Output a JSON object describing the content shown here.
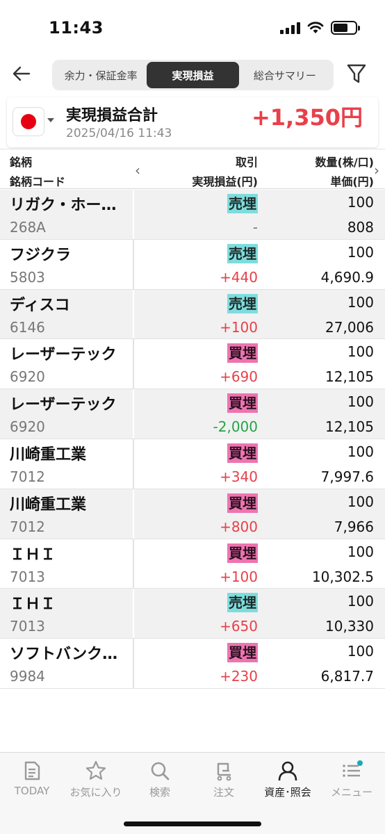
{
  "status_bar": {
    "time": "11:43"
  },
  "header": {
    "back_icon": "arrow-left-icon",
    "tabs": [
      {
        "label": "余力・保証金率",
        "active": false
      },
      {
        "label": "実現損益",
        "active": true
      },
      {
        "label": "総合サマリー",
        "active": false
      }
    ],
    "filter_icon": "filter-icon"
  },
  "summary": {
    "title": "実現損益合計",
    "date": "2025/04/16 11:43",
    "total": "+1,350円",
    "country": "Japan"
  },
  "table": {
    "headers": {
      "col1_top": "銘柄",
      "col1_bottom": "銘柄コード",
      "col2_top": "取引",
      "col2_bottom": "実現損益(円)",
      "col3_top": "数量(株/口)",
      "col3_bottom": "単価(円)"
    },
    "rows": [
      {
        "name": "リガク・ホー…",
        "code": "268A",
        "trade": "売埋",
        "trade_type": "sell",
        "pnl": "-",
        "pnl_color": "#777777",
        "qty": "100",
        "price": "808"
      },
      {
        "name": "フジクラ",
        "code": "5803",
        "trade": "売埋",
        "trade_type": "sell",
        "pnl": "+440",
        "pnl_color": "#e8404a",
        "qty": "100",
        "price": "4,690.9"
      },
      {
        "name": "ディスコ",
        "code": "6146",
        "trade": "売埋",
        "trade_type": "sell",
        "pnl": "+100",
        "pnl_color": "#e8404a",
        "qty": "100",
        "price": "27,006"
      },
      {
        "name": "レーザーテック",
        "code": "6920",
        "trade": "買埋",
        "trade_type": "buy",
        "pnl": "+690",
        "pnl_color": "#e8404a",
        "qty": "100",
        "price": "12,105"
      },
      {
        "name": "レーザーテック",
        "code": "6920",
        "trade": "買埋",
        "trade_type": "buy",
        "pnl": "-2,000",
        "pnl_color": "#22a447",
        "qty": "100",
        "price": "12,105"
      },
      {
        "name": "川崎重工業",
        "code": "7012",
        "trade": "買埋",
        "trade_type": "buy",
        "pnl": "+340",
        "pnl_color": "#e8404a",
        "qty": "100",
        "price": "7,997.6"
      },
      {
        "name": "川崎重工業",
        "code": "7012",
        "trade": "買埋",
        "trade_type": "buy",
        "pnl": "+800",
        "pnl_color": "#e8404a",
        "qty": "100",
        "price": "7,966"
      },
      {
        "name": "ＩＨＩ",
        "code": "7013",
        "trade": "買埋",
        "trade_type": "buy",
        "pnl": "+100",
        "pnl_color": "#e8404a",
        "qty": "100",
        "price": "10,302.5"
      },
      {
        "name": "ＩＨＩ",
        "code": "7013",
        "trade": "売埋",
        "trade_type": "sell",
        "pnl": "+650",
        "pnl_color": "#e8404a",
        "qty": "100",
        "price": "10,330"
      },
      {
        "name": "ソフトバンク…",
        "code": "9984",
        "trade": "買埋",
        "trade_type": "buy",
        "pnl": "+230",
        "pnl_color": "#e8404a",
        "qty": "100",
        "price": "6,817.7"
      }
    ]
  },
  "tabbar": {
    "items": [
      {
        "label": "TODAY",
        "icon": "news-icon",
        "active": false
      },
      {
        "label": "お気に入り",
        "icon": "star-icon",
        "active": false
      },
      {
        "label": "検索",
        "icon": "search-icon",
        "active": false
      },
      {
        "label": "注文",
        "icon": "cart-icon",
        "active": false
      },
      {
        "label": "資産･照会",
        "icon": "person-icon",
        "active": true
      },
      {
        "label": "メニュー",
        "icon": "menu-icon",
        "active": false
      }
    ]
  },
  "colors": {
    "profit": "#e8404a",
    "loss": "#22a447",
    "sell_badge": "#7fdcdc",
    "buy_badge": "#ee74b0",
    "notification_dot": "#1aa9b8"
  }
}
